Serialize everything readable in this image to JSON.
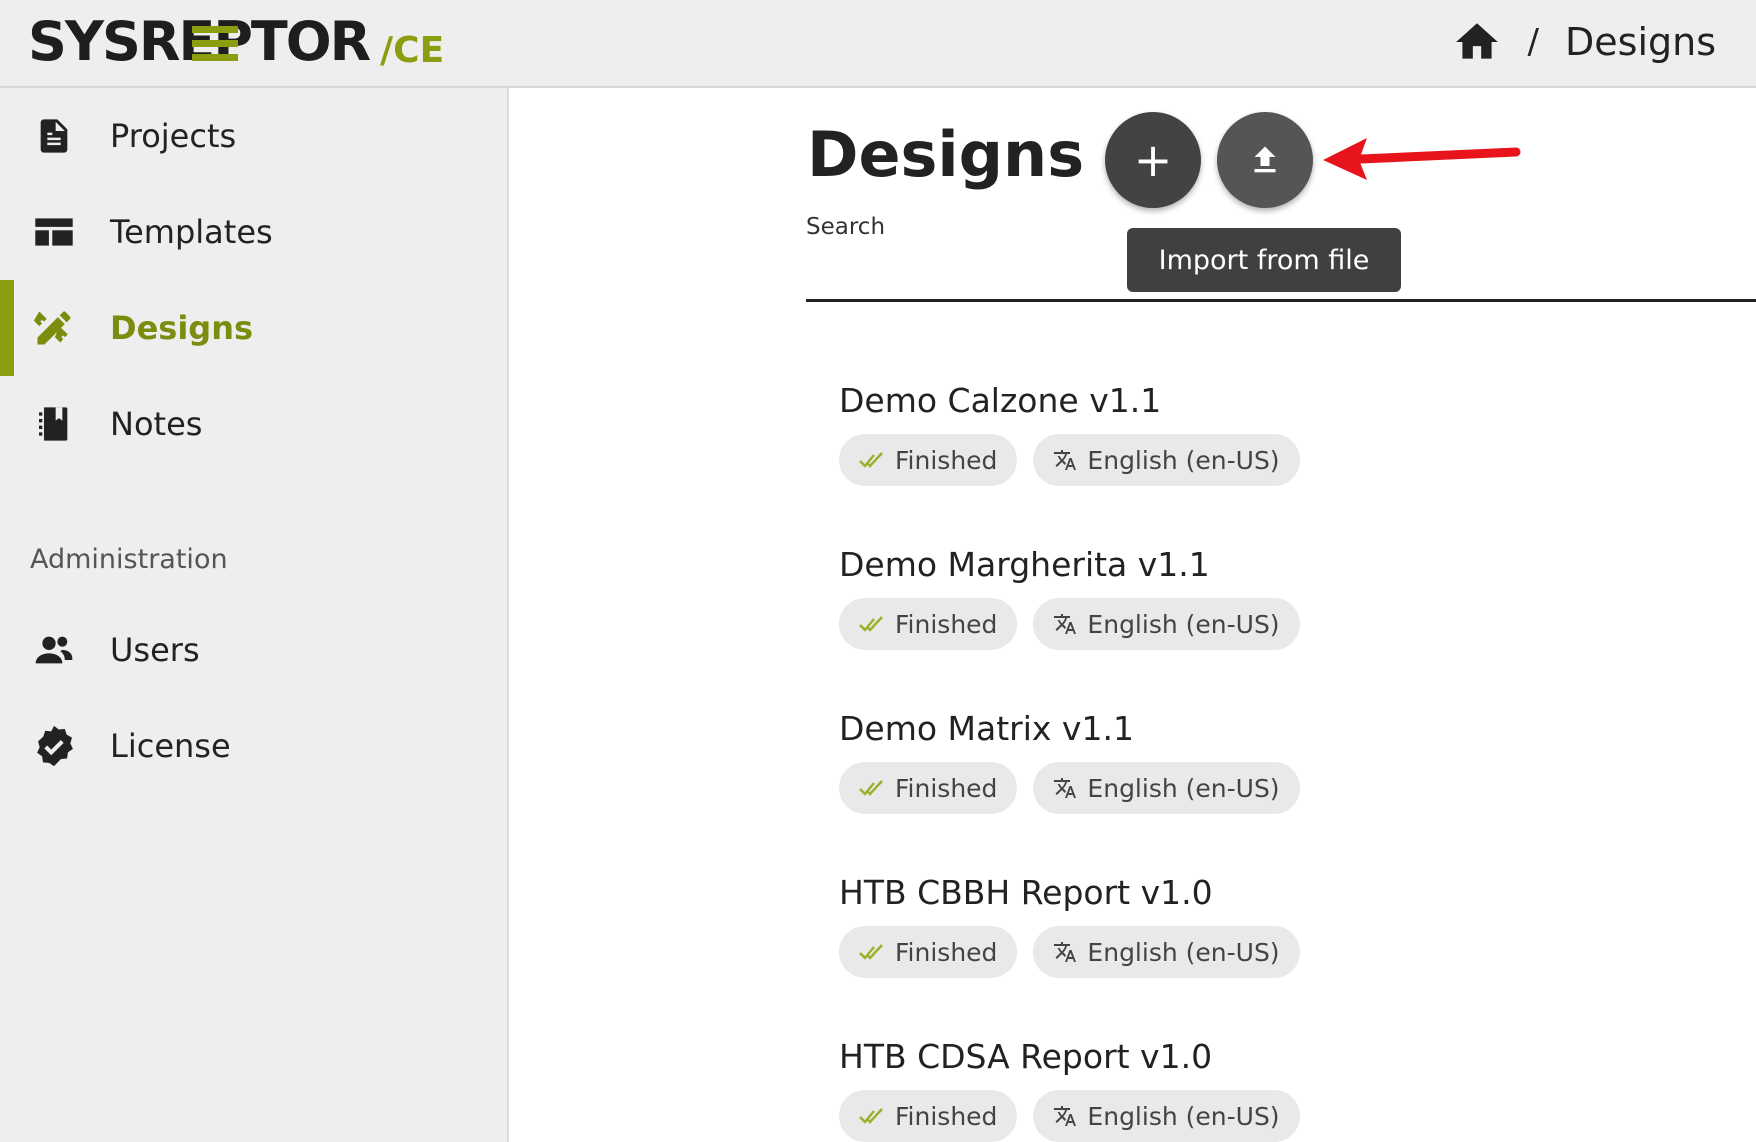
{
  "header": {
    "logo_text": "SYSREPTOR",
    "logo_suffix": "/CE",
    "breadcrumb_sep": "/",
    "breadcrumb_current": "Designs"
  },
  "sidebar": {
    "items": [
      {
        "label": "Projects",
        "icon": "file-document-icon"
      },
      {
        "label": "Templates",
        "icon": "table-icon"
      },
      {
        "label": "Designs",
        "icon": "pencil-ruler-icon",
        "active": true
      },
      {
        "label": "Notes",
        "icon": "notebook-icon"
      }
    ],
    "admin_title": "Administration",
    "admin_items": [
      {
        "label": "Users",
        "icon": "users-icon"
      },
      {
        "label": "License",
        "icon": "verified-badge-icon"
      }
    ]
  },
  "main": {
    "title": "Designs",
    "add_symbol": "+",
    "tooltip": "Import from file",
    "search_label": "Search",
    "designs": [
      {
        "name": "Demo Calzone v1.1",
        "status": "Finished",
        "language": "English (en-US)"
      },
      {
        "name": "Demo Margherita v1.1",
        "status": "Finished",
        "language": "English (en-US)"
      },
      {
        "name": "Demo Matrix v1.1",
        "status": "Finished",
        "language": "English (en-US)"
      },
      {
        "name": "HTB CBBH Report v1.0",
        "status": "Finished",
        "language": "English (en-US)"
      },
      {
        "name": "HTB CDSA Report v1.0",
        "status": "Finished",
        "language": "English (en-US)"
      }
    ]
  },
  "colors": {
    "accent": "#7b8c0f",
    "fab": "#434343",
    "annotation_arrow": "#e8141b"
  }
}
